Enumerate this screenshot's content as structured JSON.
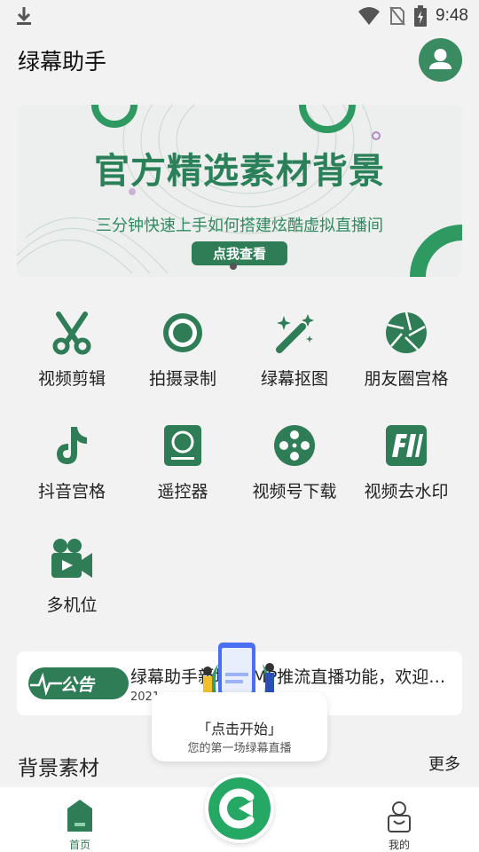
{
  "status_bar": {
    "time": "9:48"
  },
  "header": {
    "title": "绿幕助手"
  },
  "banner": {
    "headline": "官方精选素材背景",
    "subtitle": "三分钟快速上手如何搭建炫酷虚拟直播间",
    "button": "点我查看"
  },
  "features": [
    {
      "label": "视频剪辑",
      "icon": "scissors-icon"
    },
    {
      "label": "拍摄录制",
      "icon": "record-icon"
    },
    {
      "label": "绿幕抠图",
      "icon": "magic-wand-icon"
    },
    {
      "label": "朋友圈宫格",
      "icon": "aperture-icon"
    },
    {
      "label": "抖音宫格",
      "icon": "tiktok-icon"
    },
    {
      "label": "遥控器",
      "icon": "remote-icon"
    },
    {
      "label": "视频号下载",
      "icon": "film-reel-icon"
    },
    {
      "label": "视频去水印",
      "icon": "watermark-icon"
    },
    {
      "label": "多机位",
      "icon": "video-camera-icon"
    }
  ],
  "notice": {
    "badge": "公告",
    "text": "绿幕助手新增RTMP推流直播功能，欢迎大...",
    "date": "2021"
  },
  "popup": {
    "title": "「点击开始」",
    "subtitle": "您的第一场绿幕直播"
  },
  "section": {
    "title": "背景素材",
    "more": "更多"
  },
  "bottom_nav": {
    "home": "首页",
    "mine": "我的"
  },
  "colors": {
    "accent": "#2e7d56",
    "accent_bright": "#25a864",
    "background": "#f2f2f2"
  }
}
